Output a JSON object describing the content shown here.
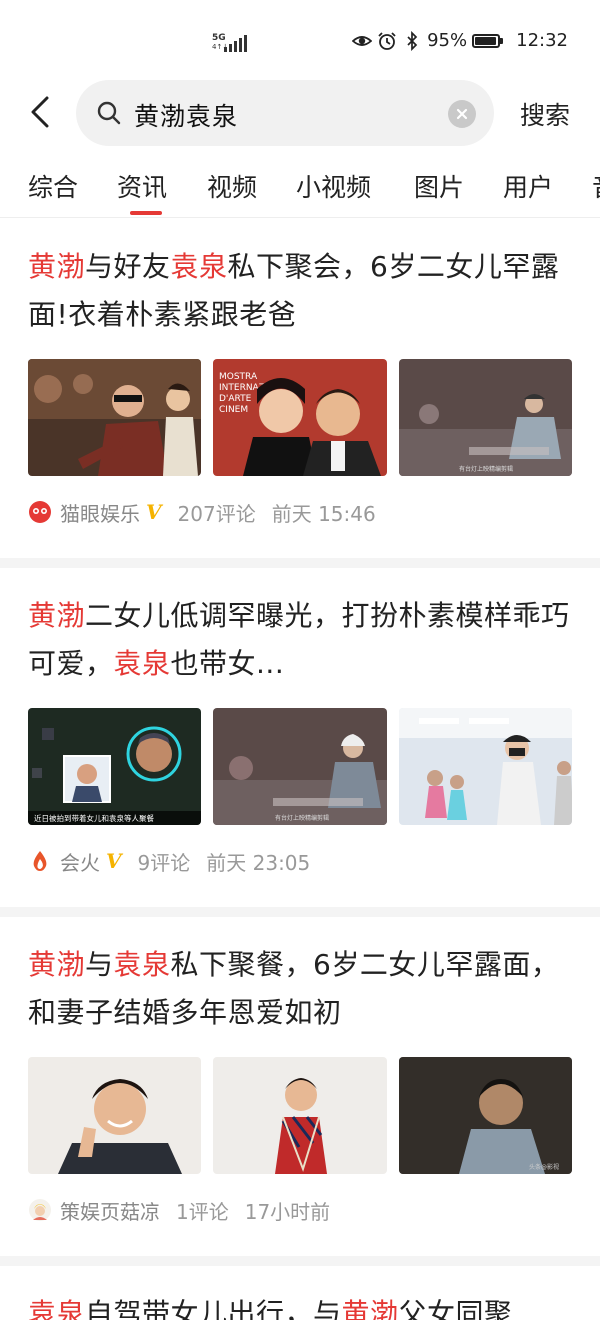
{
  "status_bar": {
    "network": "5G",
    "network_sub": "4G",
    "battery": "95%",
    "battery_level": 0.95,
    "time": "12:32"
  },
  "search": {
    "query": "黄渤袁泉",
    "submit_label": "搜索"
  },
  "tabs": [
    {
      "label": "综合"
    },
    {
      "label": "资讯"
    },
    {
      "label": "视频"
    },
    {
      "label": "小视频"
    },
    {
      "label": "图片"
    },
    {
      "label": "用户"
    },
    {
      "label": "音"
    }
  ],
  "active_tab": "资讯",
  "highlight_color": "#e53935",
  "articles": [
    {
      "title_parts": [
        {
          "text": "黄渤",
          "hl": true
        },
        {
          "text": "与好友",
          "hl": false
        },
        {
          "text": "袁泉",
          "hl": true
        },
        {
          "text": "私下聚会，6岁二女儿罕露面!衣着朴素紧跟老爸",
          "hl": false
        }
      ],
      "source": "猫眼娱乐",
      "source_icon": "maoyan-cat-icon",
      "verified": "V",
      "comments": "207评论",
      "time": "前天 15:46"
    },
    {
      "title_parts": [
        {
          "text": "黄渤",
          "hl": true
        },
        {
          "text": "二女儿低调罕曝光，打扮朴素模样乖巧可爱，",
          "hl": false
        },
        {
          "text": "袁泉",
          "hl": true
        },
        {
          "text": "也带女...",
          "hl": false
        }
      ],
      "source": "会火",
      "source_icon": "fire-drop-icon",
      "verified": "V",
      "comments": "9评论",
      "time": "前天 23:05"
    },
    {
      "title_parts": [
        {
          "text": "黄渤",
          "hl": true
        },
        {
          "text": "与",
          "hl": false
        },
        {
          "text": "袁泉",
          "hl": true
        },
        {
          "text": "私下聚餐，6岁二女儿罕露面，和妻子结婚多年恩爱如初",
          "hl": false
        }
      ],
      "source": "策娱页菇凉",
      "source_icon": "avatar-girl-icon",
      "verified": "",
      "comments": "1评论",
      "time": "17小时前"
    },
    {
      "title_parts": [
        {
          "text": "袁泉",
          "hl": true
        },
        {
          "text": "自驾带女儿出行，与",
          "hl": false
        },
        {
          "text": "黄渤",
          "hl": true
        },
        {
          "text": "父女同聚",
          "hl": false
        }
      ],
      "source": "",
      "source_icon": "",
      "verified": "",
      "comments": "",
      "time": ""
    }
  ]
}
